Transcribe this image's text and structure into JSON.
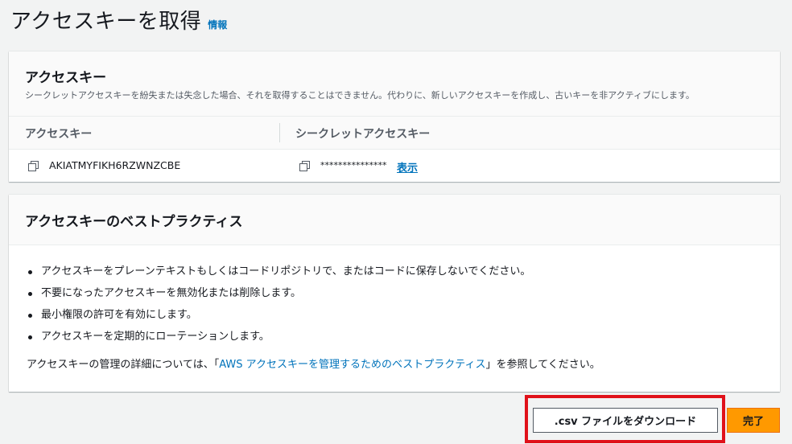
{
  "page": {
    "title": "アクセスキーを取得",
    "info_link": "情報"
  },
  "access_key_panel": {
    "title": "アクセスキー",
    "description": "シークレットアクセスキーを紛失または失念した場合、それを取得することはできません。代わりに、新しいアクセスキーを作成し、古いキーを非アクティブにします。",
    "columns": [
      "アクセスキー",
      "シークレットアクセスキー"
    ],
    "access_key_value": "AKIATMYFIKH6RZWNZCBE",
    "secret_key_masked": "***************",
    "show_link": "表示",
    "icons": [
      "copy-icon",
      "copy-icon"
    ]
  },
  "best_practices": {
    "title": "アクセスキーのベストプラクティス",
    "items": [
      "アクセスキーをプレーンテキストもしくはコードリポジトリで、またはコードに保存しないでください。",
      "不要になったアクセスキーを無効化または削除します。",
      "最小権限の許可を有効にします。",
      "アクセスキーを定期的にローテーションします。"
    ],
    "footnote_prefix": "アクセスキーの管理の詳細については、「",
    "footnote_link": "AWS アクセスキーを管理するためのベストプラクティス",
    "footnote_suffix": "」を参照してください。"
  },
  "actions": {
    "download_csv": ".csv ファイルをダウンロード",
    "done": "完了"
  },
  "colors": {
    "primary_button": "#ff9900",
    "link": "#0073bb",
    "highlight_box": "#e0111a"
  }
}
